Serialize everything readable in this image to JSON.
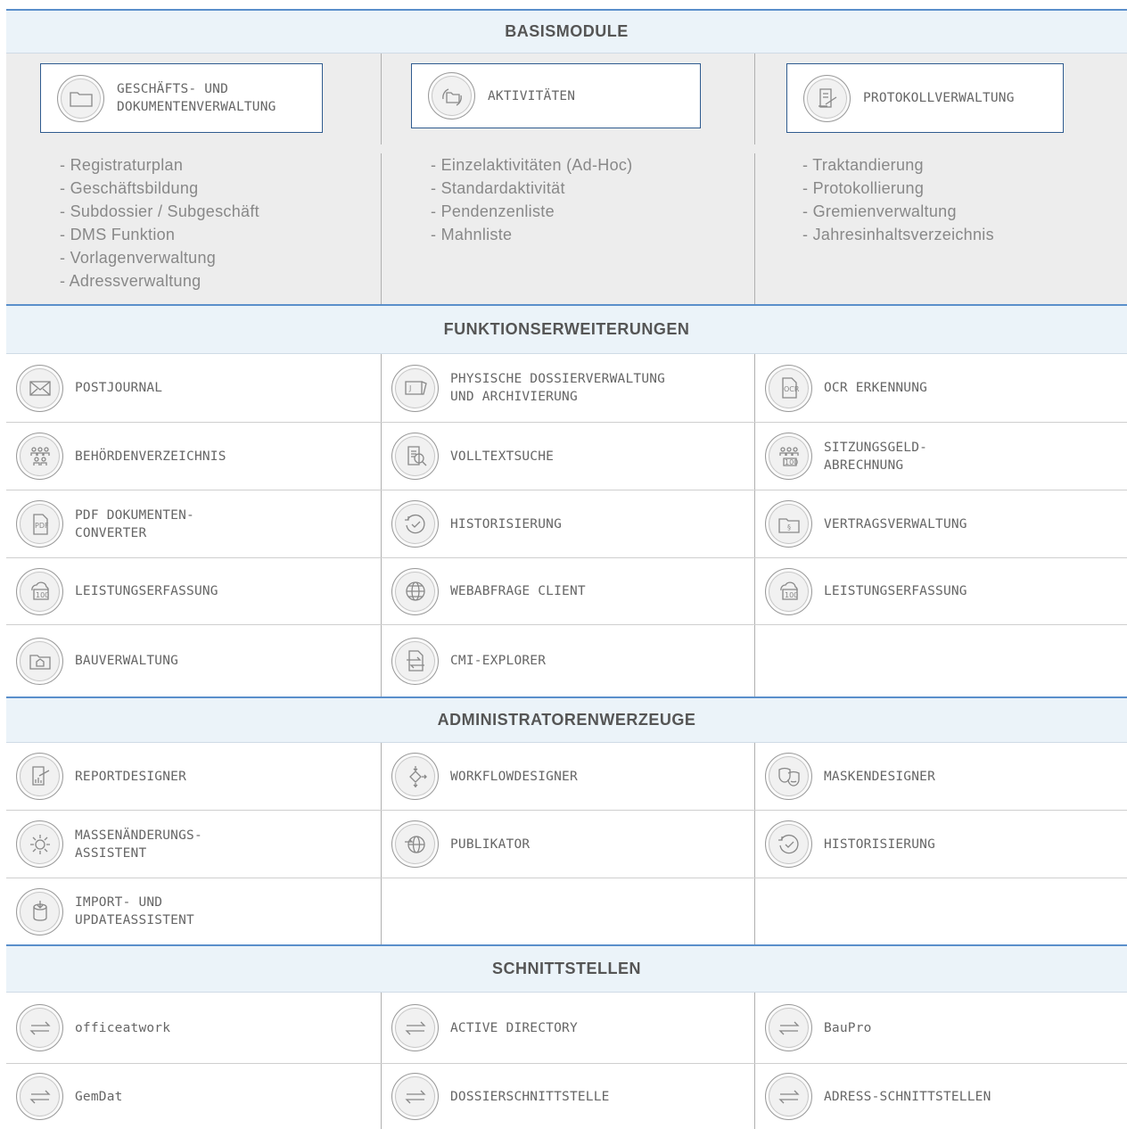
{
  "sections": {
    "basis": "BASISMODULE",
    "funktion": "FUNKTIONSERWEITERUNGEN",
    "admin": "ADMINISTRATORENWERZEUGE",
    "schnitt": "SCHNITTSTELLEN"
  },
  "basis": [
    {
      "label": "GESCHÄFTS- UND\nDOKUMENTENVERWALTUNG",
      "icon": "folder-icon",
      "items": [
        "- Registraturplan",
        "- Geschäftsbildung",
        "- Subdossier / Subgeschäft",
        "- DMS Funktion",
        "- Vorlagenverwaltung",
        "- Adressverwaltung"
      ]
    },
    {
      "label": "AKTIVITÄTEN",
      "icon": "activity-folder-icon",
      "items": [
        "- Einzelaktivitäten (Ad-Hoc)",
        "- Standardaktivität",
        "- Pendenzenliste",
        "- Mahnliste"
      ]
    },
    {
      "label": "PROTOKOLLVERWALTUNG",
      "icon": "protocol-icon",
      "items": [
        "- Traktandierung",
        "- Protokollierung",
        "- Gremienverwaltung",
        "- Jahresinhaltsverzeichnis"
      ]
    }
  ],
  "funktion": [
    [
      "POSTJOURNAL",
      "PHYSISCHE DOSSIERVERWALTUNG\nUND ARCHIVIERUNG",
      "OCR ERKENNUNG"
    ],
    [
      "BEHÖRDENVERZEICHNIS",
      "VOLLTEXTSUCHE",
      "SITZUNGSGELD-\nABRECHNUNG"
    ],
    [
      "PDF DOKUMENTEN-\nCONVERTER",
      "HISTORISIERUNG",
      "VERTRAGSVERWALTUNG"
    ],
    [
      "LEISTUNGSERFASSUNG",
      "WEBABFRAGE CLIENT",
      "LEISTUNGSERFASSUNG"
    ],
    [
      "BAUVERWALTUNG",
      "CMI-EXPLORER",
      ""
    ]
  ],
  "admin": [
    [
      "REPORTDESIGNER",
      "WORKFLOWDESIGNER",
      "MASKENDESIGNER"
    ],
    [
      "MASSENÄNDERUNGS-\nASSISTENT",
      "PUBLIKATOR",
      "HISTORISIERUNG"
    ],
    [
      "IMPORT- UND\nUPDATEASSISTENT",
      "",
      ""
    ]
  ],
  "schnitt": [
    [
      "officeatwork",
      "ACTIVE DIRECTORY",
      "BauPro"
    ],
    [
      "GemDat",
      "DOSSIERSCHNITTSTELLE",
      "ADRESS-SCHNITTSTELLEN"
    ]
  ]
}
